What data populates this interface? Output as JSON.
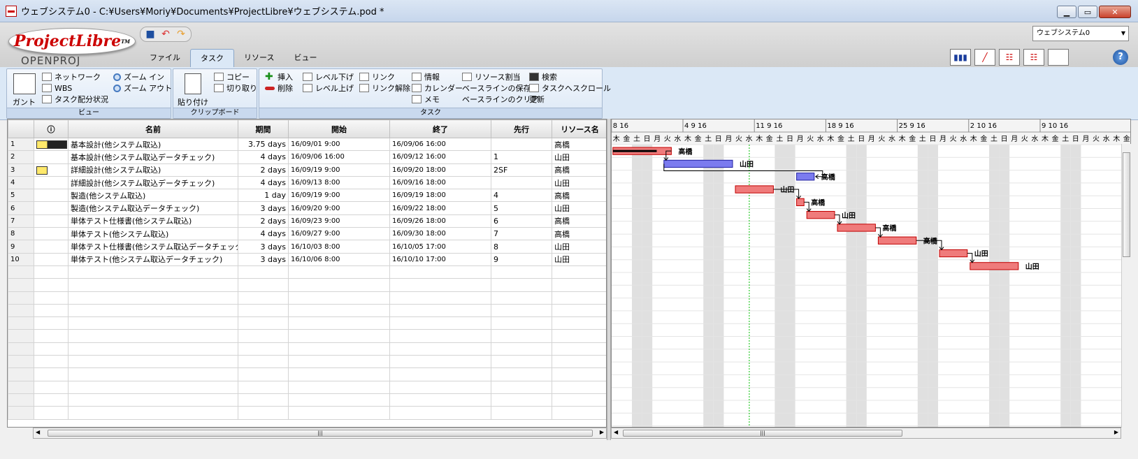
{
  "window": {
    "title": "ウェブシステム0 - C:¥Users¥Moriy¥Documents¥ProjectLibre¥ウェブシステム.pod *",
    "min": "▁",
    "max": "▭",
    "close": "✕"
  },
  "logo": {
    "main": "Project",
    "italic": "Libre",
    "tm": "TM",
    "sub": "OPENPROJ"
  },
  "tabs": [
    "ファイル",
    "タスク",
    "リソース",
    "ビュー"
  ],
  "selected_tab": "タスク",
  "project_select": "ウェブシステム0",
  "help": "?",
  "ribbon": {
    "view": {
      "label": "ビュー",
      "gantt": "ガント",
      "network": "ネットワーク",
      "wbs": "WBS",
      "usage": "タスク配分状況",
      "zoom_in": "ズーム イン",
      "zoom_out": "ズーム アウト"
    },
    "clipboard": {
      "label": "クリップボード",
      "paste": "貼り付け",
      "copy": "コピー",
      "cut": "切り取り"
    },
    "task": {
      "label": "タスク",
      "insert": "挿入",
      "delete": "削除",
      "indent": "レベル下げ",
      "outdent": "レベル上げ",
      "link": "リンク",
      "unlink": "リンク解除",
      "info": "情報",
      "calendar": "カレンダー",
      "notes": "メモ",
      "assign": "リソース割当",
      "save_baseline": "ベースラインの保存",
      "clear_baseline": "ベースラインのクリア",
      "find": "検索",
      "scroll_to_task": "タスクへスクロール",
      "update": "更新"
    }
  },
  "table": {
    "headers": [
      "",
      "ⓘ",
      "名前",
      "期間",
      "開始",
      "終了",
      "先行",
      "リソース名"
    ],
    "rows": [
      {
        "n": "1",
        "icon": "dark",
        "name": "基本設計(他システム取込)",
        "dur": "3.75 days",
        "start": "16/09/01 9:00",
        "end": "16/09/06 16:00",
        "pred": "",
        "res": "高橋"
      },
      {
        "n": "2",
        "icon": "",
        "name": "基本設計(他システム取込データチェック)",
        "dur": "4 days",
        "start": "16/09/06 16:00",
        "end": "16/09/12 16:00",
        "pred": "1",
        "res": "山田"
      },
      {
        "n": "3",
        "icon": "yellow",
        "name": "詳細設計(他システム取込)",
        "dur": "2 days",
        "start": "16/09/19 9:00",
        "end": "16/09/20 18:00",
        "pred": "2SF",
        "res": "高橋"
      },
      {
        "n": "4",
        "icon": "",
        "name": "詳細設計(他システム取込データチェック)",
        "dur": "4 days",
        "start": "16/09/13 8:00",
        "end": "16/09/16 18:00",
        "pred": "",
        "res": "山田"
      },
      {
        "n": "5",
        "icon": "",
        "name": "製造(他システム取込)",
        "dur": "1 day",
        "start": "16/09/19 9:00",
        "end": "16/09/19 18:00",
        "pred": "4",
        "res": "高橋"
      },
      {
        "n": "6",
        "icon": "",
        "name": "製造(他システム取込データチェック)",
        "dur": "3 days",
        "start": "16/09/20 9:00",
        "end": "16/09/22 18:00",
        "pred": "5",
        "res": "山田"
      },
      {
        "n": "7",
        "icon": "",
        "name": "単体テスト仕様書(他システム取込)",
        "dur": "2 days",
        "start": "16/09/23 9:00",
        "end": "16/09/26 18:00",
        "pred": "6",
        "res": "高橋"
      },
      {
        "n": "8",
        "icon": "",
        "name": "単体テスト(他システム取込)",
        "dur": "4 days",
        "start": "16/09/27 9:00",
        "end": "16/09/30 18:00",
        "pred": "7",
        "res": "高橋"
      },
      {
        "n": "9",
        "icon": "",
        "name": "単体テスト仕様書(他システム取込データチェック)",
        "dur": "3 days",
        "start": "16/10/03 8:00",
        "end": "16/10/05 17:00",
        "pred": "8",
        "res": "山田"
      },
      {
        "n": "10",
        "icon": "",
        "name": "単体テスト(他システム取込データチェック)",
        "dur": "3 days",
        "start": "16/10/06 8:00",
        "end": "16/10/10 17:00",
        "pred": "9",
        "res": "山田"
      }
    ],
    "empty_rows": 12
  },
  "gantt": {
    "weeks": [
      "8 16",
      "4 9 16",
      "11 9 16",
      "18 9 16",
      "25 9 16",
      "2 10 16",
      "9 10 16"
    ],
    "days": [
      "月",
      "火",
      "水",
      "木",
      "金",
      "土",
      "日"
    ],
    "first_day": "2016-08-29",
    "today": "2016-09-14",
    "bars": [
      {
        "row": 0,
        "start": "2016-09-01",
        "end": "2016-09-06",
        "label": "高橋",
        "color": "red",
        "progress": 0.75
      },
      {
        "row": 1,
        "start": "2016-09-06",
        "end": "2016-09-12",
        "label": "山田",
        "color": "blue"
      },
      {
        "row": 2,
        "start": "2016-09-19",
        "end": "2016-09-20",
        "label": "高橋",
        "color": "blue"
      },
      {
        "row": 3,
        "start": "2016-09-13",
        "end": "2016-09-16",
        "label": "山田",
        "color": "red"
      },
      {
        "row": 4,
        "start": "2016-09-19",
        "end": "2016-09-19",
        "label": "高橋",
        "color": "red"
      },
      {
        "row": 5,
        "start": "2016-09-20",
        "end": "2016-09-22",
        "label": "山田",
        "color": "red"
      },
      {
        "row": 6,
        "start": "2016-09-23",
        "end": "2016-09-26",
        "label": "高橋",
        "color": "red"
      },
      {
        "row": 7,
        "start": "2016-09-27",
        "end": "2016-09-30",
        "label": "高橋",
        "color": "red"
      },
      {
        "row": 8,
        "start": "2016-10-03",
        "end": "2016-10-05",
        "label": "山田",
        "color": "red"
      },
      {
        "row": 9,
        "start": "2016-10-06",
        "end": "2016-10-10",
        "label": "山田",
        "color": "red"
      }
    ],
    "links": [
      [
        0,
        1
      ],
      [
        3,
        4
      ],
      [
        4,
        5
      ],
      [
        5,
        6
      ],
      [
        6,
        7
      ],
      [
        7,
        8
      ],
      [
        8,
        9
      ]
    ],
    "sf_link": [
      1,
      2
    ]
  },
  "colors": {
    "red": "#ef7b7b",
    "red_border": "#c00000",
    "blue": "#7b7bef",
    "blue_border": "#2020a0",
    "today": "#00c000",
    "weekend": "#e0e0e0"
  }
}
